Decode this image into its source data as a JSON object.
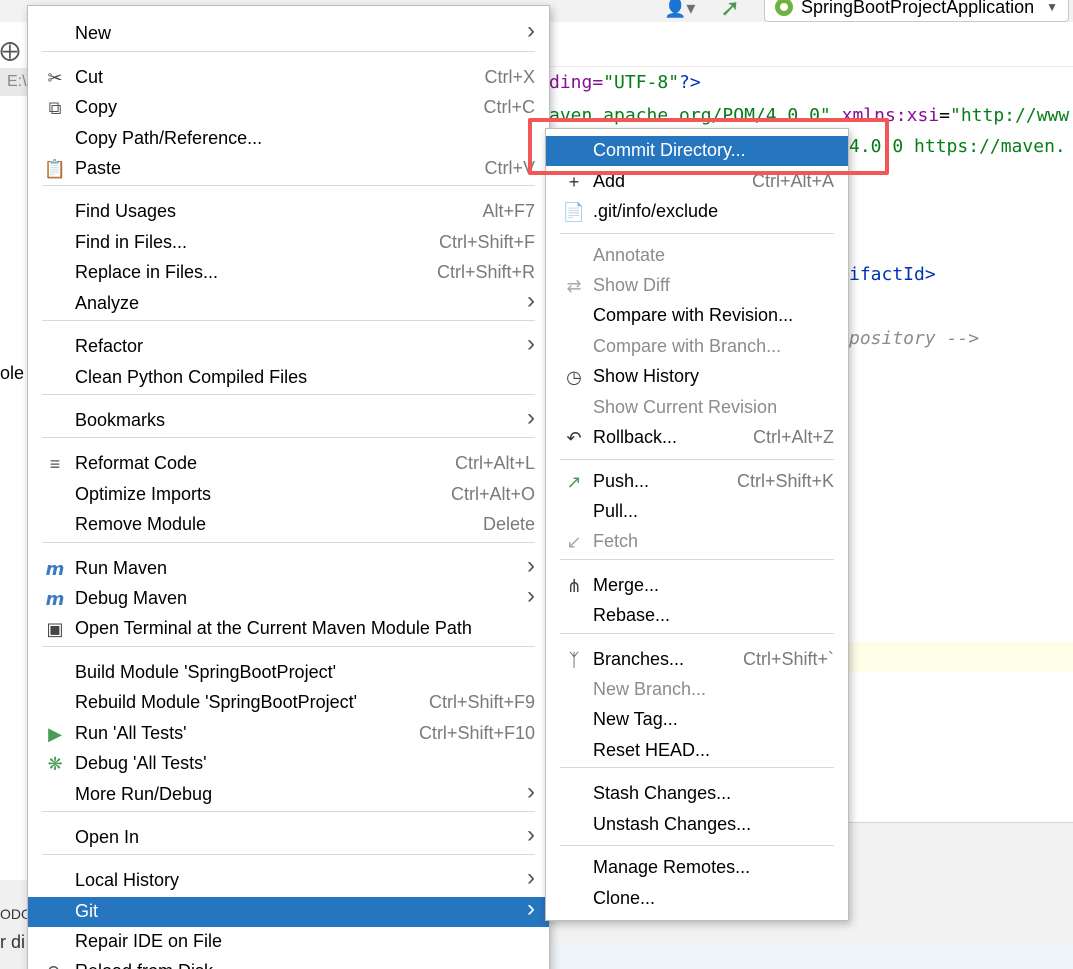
{
  "toolbar": {
    "run_config": "SpringBootProjectApplication"
  },
  "project": {
    "path_fragment": "E:\\",
    "cut_text": "ole"
  },
  "bottom": {
    "tab_fragment": "ODO",
    "text_fragment": "r di"
  },
  "editor": {
    "lines": [
      {
        "parts": [
          {
            "t": "ding=",
            "c": "attr"
          },
          {
            "t": "\"UTF-8\"",
            "c": "str"
          },
          {
            "t": "?>",
            "c": "tag"
          }
        ]
      },
      {
        "parts": [
          {
            "t": "aven.apache.org/POM/4.0.0\" ",
            "c": "str"
          },
          {
            "t": "xmlns:xsi",
            "c": "attr"
          },
          {
            "t": "=",
            "c": ""
          },
          {
            "t": "\"http://www",
            "c": "str"
          }
        ]
      },
      {
        "parts": [
          {
            "t": "4.0.0 https://maven.",
            "c": "str"
          }
        ]
      },
      {
        "parts": [
          {
            "t": "ifactId>",
            "c": "tag"
          }
        ]
      },
      {
        "parts": [
          {
            "t": "pository -->",
            "c": "cmt"
          }
        ]
      }
    ]
  },
  "main_menu": {
    "items": [
      {
        "label": "New",
        "submenu": true
      },
      {
        "label": "Cut",
        "shortcut": "Ctrl+X",
        "icon": "cut-icon"
      },
      {
        "label": "Copy",
        "shortcut": "Ctrl+C",
        "icon": "copy-icon"
      },
      {
        "label": "Copy Path/Reference..."
      },
      {
        "label": "Paste",
        "shortcut": "Ctrl+V",
        "icon": "paste-icon"
      },
      {
        "label": "Find Usages",
        "shortcut": "Alt+F7"
      },
      {
        "label": "Find in Files...",
        "shortcut": "Ctrl+Shift+F"
      },
      {
        "label": "Replace in Files...",
        "shortcut": "Ctrl+Shift+R"
      },
      {
        "label": "Analyze",
        "submenu": true
      },
      {
        "label": "Refactor",
        "submenu": true
      },
      {
        "label": "Clean Python Compiled Files"
      },
      {
        "label": "Bookmarks",
        "submenu": true
      },
      {
        "label": "Reformat Code",
        "shortcut": "Ctrl+Alt+L",
        "icon": "reformat-icon"
      },
      {
        "label": "Optimize Imports",
        "shortcut": "Ctrl+Alt+O"
      },
      {
        "label": "Remove Module",
        "shortcut": "Delete"
      },
      {
        "label": "Run Maven",
        "submenu": true,
        "icon": "maven-run-icon"
      },
      {
        "label": "Debug Maven",
        "submenu": true,
        "icon": "maven-debug-icon"
      },
      {
        "label": "Open Terminal at the Current Maven Module Path",
        "icon": "maven-terminal-icon"
      },
      {
        "label": "Build Module 'SpringBootProject'"
      },
      {
        "label": "Rebuild Module 'SpringBootProject'",
        "shortcut": "Ctrl+Shift+F9"
      },
      {
        "label": "Run 'All Tests'",
        "shortcut": "Ctrl+Shift+F10",
        "icon": "run-icon"
      },
      {
        "label": "Debug 'All Tests'",
        "icon": "debug-icon"
      },
      {
        "label": "More Run/Debug",
        "submenu": true
      },
      {
        "label": "Open In",
        "submenu": true
      },
      {
        "label": "Local History",
        "submenu": true
      },
      {
        "label": "Git",
        "submenu": true,
        "selected": true
      },
      {
        "label": "Repair IDE on File"
      },
      {
        "label": "Reload from Disk",
        "icon": "reload-icon"
      }
    ]
  },
  "git_menu": {
    "items": [
      {
        "label": "Commit Directory...",
        "selected": true
      },
      {
        "label": "Add",
        "shortcut": "Ctrl+Alt+A",
        "icon": "plus-icon"
      },
      {
        "label": ".git/info/exclude",
        "icon": "ignore-file-icon"
      },
      {
        "label": "Annotate",
        "disabled": true
      },
      {
        "label": "Show Diff",
        "disabled": true,
        "icon": "diff-icon"
      },
      {
        "label": "Compare with Revision..."
      },
      {
        "label": "Compare with Branch...",
        "disabled": true
      },
      {
        "label": "Show History",
        "icon": "history-icon"
      },
      {
        "label": "Show Current Revision",
        "disabled": true
      },
      {
        "label": "Rollback...",
        "shortcut": "Ctrl+Alt+Z",
        "icon": "rollback-icon"
      },
      {
        "label": "Push...",
        "shortcut": "Ctrl+Shift+K",
        "icon": "push-icon"
      },
      {
        "label": "Pull..."
      },
      {
        "label": "Fetch",
        "disabled": true,
        "icon": "fetch-icon"
      },
      {
        "label": "Merge...",
        "icon": "merge-icon"
      },
      {
        "label": "Rebase..."
      },
      {
        "label": "Branches...",
        "shortcut": "Ctrl+Shift+`",
        "icon": "branch-icon"
      },
      {
        "label": "New Branch...",
        "disabled": true
      },
      {
        "label": "New Tag..."
      },
      {
        "label": "Reset HEAD..."
      },
      {
        "label": "Stash Changes..."
      },
      {
        "label": "Unstash Changes..."
      },
      {
        "label": "Manage Remotes..."
      },
      {
        "label": "Clone..."
      }
    ]
  },
  "colors": {
    "selection": "#2675bf",
    "highlight_box": "#f25757",
    "disabled_text": "#8c8c8c"
  }
}
